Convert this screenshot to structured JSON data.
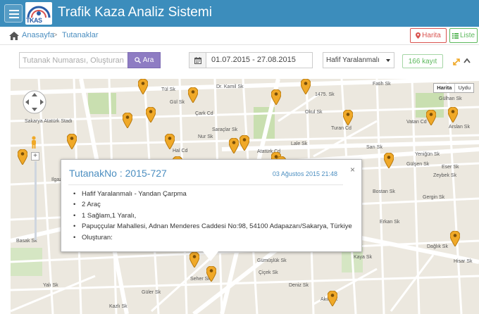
{
  "app": {
    "logo_text": "TKAS",
    "title": "Trafik Kaza Analiz Sistemi"
  },
  "breadcrumb": {
    "home": "Anasayfa",
    "separator": ">",
    "current": "Tutanaklar"
  },
  "view_buttons": {
    "map": "Harita",
    "list": "Liste"
  },
  "filters": {
    "search_placeholder": "Tutanak Numarası, Oluşturan",
    "search_button": "Ara",
    "date_range": "01.07.2015 - 27.08.2015",
    "severity_selected": "Hafif Yaralanmalı",
    "record_count": "166 kayıt"
  },
  "map": {
    "type_buttons": [
      "Harita",
      "Uydu"
    ],
    "street_labels": [
      "Tül Sk",
      "Dr. Kamil Sk",
      "1475. Sk",
      "Fatih Sk",
      "Gülhan Sk",
      "Sakarya Atatürk Stadı",
      "Çark Cd",
      "Turan Cd",
      "Arslan Sk",
      "Saraçlar Sk",
      "Nur Sk",
      "Vatan Cd",
      "Hal Cd",
      "Yeniğün Sk",
      "Gülşen Sk",
      "Zeybek Sk",
      "Gergin Sk",
      "Dağlık Sk",
      "Hisar Sk",
      "Bostan Sk",
      "Erkan Sk",
      "Güler Sk",
      "Gümüşlük Sk",
      "Deniz Sk",
      "Eser Sk",
      "Çiçek Sk",
      "Kaya Sk",
      "Kazlı Sk",
      "Basak Sk",
      "Seher Sk",
      "Yalı Sk",
      "Akın Sk",
      "Gül Sk",
      "Lale Sk",
      "Ilgaz Cd",
      "Atatürk Cd",
      "Okul Sk",
      "Sarı Sk"
    ],
    "colors": {
      "pin": "#f0a928",
      "pin_border": "#b87a10",
      "main_road": "#ffffff",
      "background": "#ece8df",
      "park": "#c9dfb0",
      "topbar": "#3c8dbc"
    }
  },
  "info_window": {
    "title": "TutanakNo : 2015-727",
    "date": "03 Ağustos 2015 21:48",
    "close": "×",
    "details": [
      "Hafif Yaralanmalı - Yandan Çarpma",
      "2 Araç",
      "1 Sağlam,1 Yaralı,",
      "Papuççular Mahallesi, Adnan Menderes Caddesi No:98, 54100 Adapazarı/Sakarya, Türkiye",
      "Oluşturan:"
    ]
  }
}
